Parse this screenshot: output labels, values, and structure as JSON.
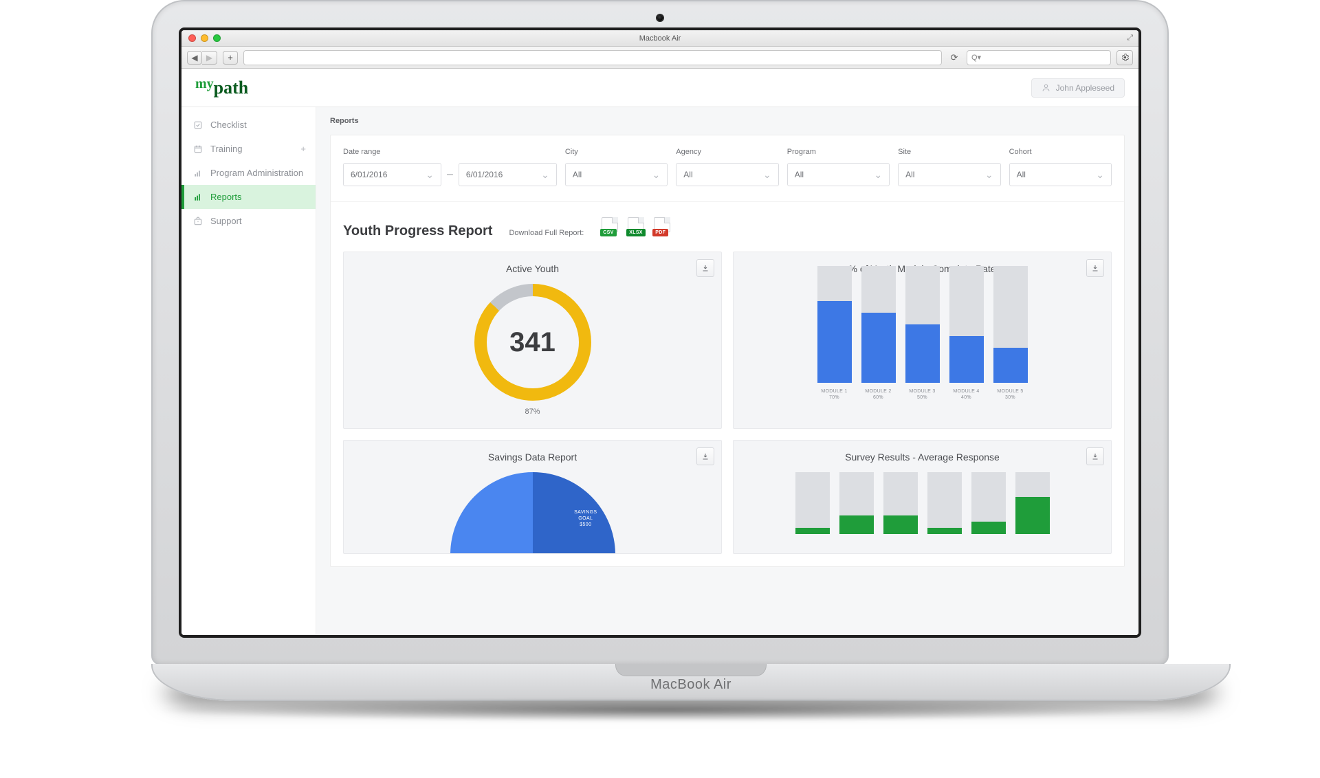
{
  "device": {
    "model_prefix": "MacBook",
    "model_suffix": "Air",
    "window_title": "Macbook Air"
  },
  "browser": {
    "search_placeholder": "Q▾"
  },
  "logo": {
    "prefix": "my",
    "suffix": "path"
  },
  "user": {
    "name": "John Appleseed"
  },
  "sidebar": {
    "items": [
      {
        "label": "Checklist",
        "icon": "checklist-icon"
      },
      {
        "label": "Training",
        "icon": "training-icon",
        "expandable": true
      },
      {
        "label": "Program Administration",
        "icon": "admin-icon"
      },
      {
        "label": "Reports",
        "icon": "reports-icon",
        "active": true
      },
      {
        "label": "Support",
        "icon": "support-icon"
      }
    ]
  },
  "breadcrumb": "Reports",
  "filters": {
    "date_range": {
      "label": "Date range",
      "from": "6/01/2016",
      "to": "6/01/2016"
    },
    "city": {
      "label": "City",
      "value": "All"
    },
    "agency": {
      "label": "Agency",
      "value": "All"
    },
    "program": {
      "label": "Program",
      "value": "All"
    },
    "site": {
      "label": "Site",
      "value": "All"
    },
    "cohort": {
      "label": "Cohort",
      "value": "All"
    }
  },
  "report": {
    "title": "Youth Progress Report",
    "download_label": "Download Full Report:",
    "formats": [
      "CSV",
      "XLSX",
      "PDF"
    ]
  },
  "cards": {
    "a": {
      "title": "Active Youth",
      "value": "341",
      "percent_label": "87%"
    },
    "b": {
      "title": "% of Youth Module Complete Rate"
    },
    "c": {
      "title": "Savings Data Report",
      "slice_label_l1": "SAVINGS",
      "slice_label_l2": "GOAL",
      "slice_label_l3": "$500"
    },
    "d": {
      "title": "Survey Results - Average Response"
    }
  },
  "chart_data": [
    {
      "id": "active_youth",
      "type": "donut",
      "title": "Active Youth",
      "value": 341,
      "percent": 87,
      "colors": {
        "fill": "#f1b90f",
        "remainder": "#c3c6cb"
      }
    },
    {
      "id": "module_complete",
      "type": "bar",
      "title": "% of Youth Module Complete Rate",
      "categories": [
        "MODULE 1",
        "MODULE 2",
        "MODULE 3",
        "MODULE 4",
        "MODULE 5"
      ],
      "values": [
        70,
        60,
        50,
        40,
        30
      ],
      "value_labels": [
        "70%",
        "60%",
        "50%",
        "40%",
        "30%"
      ],
      "ylim": [
        0,
        100
      ],
      "bar_color": "#3d78e5",
      "track_color": "#dcdee2"
    },
    {
      "id": "savings_data",
      "type": "pie",
      "title": "Savings Data Report",
      "series": [
        {
          "name": "SAVINGS GOAL $500",
          "value": 55
        },
        {
          "name": "",
          "value": 45
        }
      ],
      "colors": [
        "#2f65c9",
        "#4a86f0"
      ]
    },
    {
      "id": "survey_results",
      "type": "bar",
      "title": "Survey Results - Average Response",
      "categories": [
        "",
        "",
        "",
        "",
        "",
        ""
      ],
      "values": [
        10,
        30,
        30,
        10,
        20,
        60
      ],
      "ylim": [
        0,
        100
      ],
      "bar_color": "#1f9d3a",
      "track_color": "#dcdee2"
    }
  ]
}
